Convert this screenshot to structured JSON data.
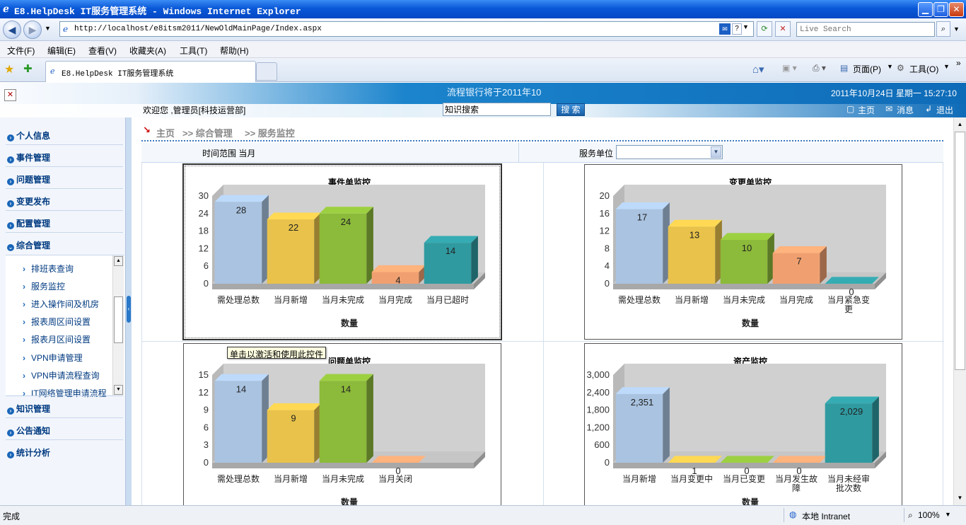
{
  "window": {
    "title": "E8.HelpDesk IT服务管理系统 - Windows Internet Explorer"
  },
  "browser": {
    "url": "http://localhost/e8itsm2011/NewOldMainPage/Index.aspx",
    "search_placeholder": "Live Search",
    "menu": [
      "文件(F)",
      "编辑(E)",
      "查看(V)",
      "收藏夹(A)",
      "工具(T)",
      "帮助(H)"
    ],
    "tab_title": "E8.HelpDesk IT服务管理系统",
    "toolbar": {
      "page": "页面(P)",
      "tools": "工具(O)"
    },
    "status": "完成",
    "zone": "本地 Intranet",
    "zoom": "100%"
  },
  "header": {
    "marquee": "流程银行将于2011年10",
    "datetime": "2011年10月24日 星期一 15:27:10",
    "welcome": "欢迎您 ,管理员[科技运营部]",
    "search_value": "知识搜索",
    "search_button": "搜 索",
    "links": {
      "home": "主页",
      "messages": "消息",
      "logout": "退出"
    }
  },
  "sidebar": {
    "groups_top": [
      "个人信息",
      "事件管理",
      "问题管理",
      "变更发布",
      "配置管理",
      "综合管理"
    ],
    "sub_items": [
      "排班表查询",
      "服务监控",
      "进入操作间及机房",
      "报表周区间设置",
      "报表月区间设置",
      "VPN申请管理",
      "VPN申请流程查询",
      "IT网络管理申请流程"
    ],
    "groups_bottom": [
      "知识管理",
      "公告通知",
      "统计分析"
    ]
  },
  "breadcrumb": {
    "home": "主页",
    "sep1": ">> 综合管理",
    "sep2": ">> 服务监控"
  },
  "filters": {
    "time_label": "时间范围 当月",
    "unit_label": "服务单位",
    "unit_value": ""
  },
  "tooltip": "单击以激活和使用此控件",
  "chart_data": [
    {
      "type": "bar",
      "title": "事件单监控",
      "xlabel": "数量",
      "categories": [
        "需处理总数",
        "当月新增",
        "当月未完成",
        "当月完成",
        "当月已超时"
      ],
      "values": [
        28,
        22,
        24,
        4,
        14
      ],
      "ylim": [
        0,
        30
      ],
      "yticks": [
        0,
        6,
        12,
        18,
        24,
        30
      ],
      "colors": [
        "#a9c3e0",
        "#e8c24a",
        "#8cba3a",
        "#f0a070",
        "#2f9aa0"
      ]
    },
    {
      "type": "bar",
      "title": "变更单监控",
      "xlabel": "数量",
      "categories": [
        "需处理总数",
        "当月新增",
        "当月未完成",
        "当月完成",
        "当月紧急变更"
      ],
      "values": [
        17,
        13,
        10,
        7,
        0
      ],
      "ylim": [
        0,
        20
      ],
      "yticks": [
        0,
        4,
        8,
        12,
        16,
        20
      ],
      "colors": [
        "#a9c3e0",
        "#e8c24a",
        "#8cba3a",
        "#f0a070",
        "#2f9aa0"
      ]
    },
    {
      "type": "bar",
      "title": "问题单监控",
      "xlabel": "数量",
      "categories": [
        "需处理总数",
        "当月新增",
        "当月未完成",
        "当月关闭"
      ],
      "values": [
        14,
        9,
        14,
        0
      ],
      "ylim": [
        0,
        15
      ],
      "yticks": [
        0,
        3,
        6,
        9,
        12,
        15
      ],
      "colors": [
        "#a9c3e0",
        "#e8c24a",
        "#8cba3a",
        "#f0a070"
      ]
    },
    {
      "type": "bar",
      "title": "资产监控",
      "xlabel": "数量",
      "categories": [
        "当月新增",
        "当月变更中",
        "当月已变更",
        "当月发生故障",
        "当月未经审批次数"
      ],
      "values": [
        2351,
        1,
        0,
        0,
        2029
      ],
      "value_labels": [
        "2,351",
        "1",
        "0",
        "0",
        "2,029"
      ],
      "ylim": [
        0,
        3000
      ],
      "yticks": [
        0,
        600,
        1200,
        1800,
        2400,
        3000
      ],
      "ytick_labels": [
        "0",
        "600",
        "1,200",
        "1,800",
        "2,400",
        "3,000"
      ],
      "colors": [
        "#a9c3e0",
        "#e8c24a",
        "#8cba3a",
        "#f0a070",
        "#2f9aa0"
      ]
    }
  ]
}
